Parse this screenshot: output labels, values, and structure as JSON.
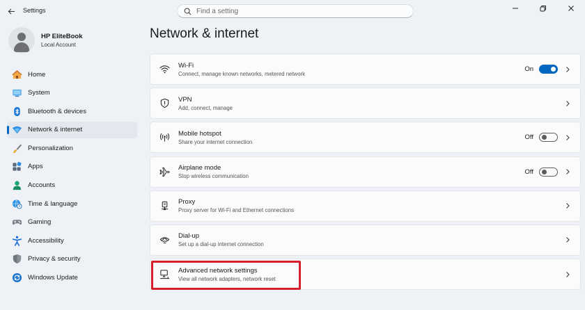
{
  "window": {
    "app_title": "Settings"
  },
  "search": {
    "placeholder": "Find a setting",
    "value": ""
  },
  "profile": {
    "name": "HP EliteBook",
    "account_type": "Local Account"
  },
  "sidebar": {
    "items": [
      {
        "label": "Home",
        "icon": "home-icon",
        "active": false
      },
      {
        "label": "System",
        "icon": "monitor-icon",
        "active": false
      },
      {
        "label": "Bluetooth & devices",
        "icon": "bluetooth-icon",
        "active": false
      },
      {
        "label": "Network & internet",
        "icon": "wifi-diamond-icon",
        "active": true
      },
      {
        "label": "Personalization",
        "icon": "brush-icon",
        "active": false
      },
      {
        "label": "Apps",
        "icon": "apps-icon",
        "active": false
      },
      {
        "label": "Accounts",
        "icon": "person-icon",
        "active": false
      },
      {
        "label": "Time & language",
        "icon": "globe-clock-icon",
        "active": false
      },
      {
        "label": "Gaming",
        "icon": "gamepad-icon",
        "active": false
      },
      {
        "label": "Accessibility",
        "icon": "accessibility-icon",
        "active": false
      },
      {
        "label": "Privacy & security",
        "icon": "shield-icon",
        "active": false
      },
      {
        "label": "Windows Update",
        "icon": "update-icon",
        "active": false
      }
    ]
  },
  "main": {
    "title": "Network & internet",
    "cards": [
      {
        "title": "Wi-Fi",
        "description": "Connect, manage known networks, metered network",
        "icon": "wifi-icon",
        "toggle": "On"
      },
      {
        "title": "VPN",
        "description": "Add, connect, manage",
        "icon": "vpn-shield-icon",
        "toggle": null
      },
      {
        "title": "Mobile hotspot",
        "description": "Share your internet connection",
        "icon": "hotspot-icon",
        "toggle": "Off"
      },
      {
        "title": "Airplane mode",
        "description": "Stop wireless communication",
        "icon": "airplane-icon",
        "toggle": "Off"
      },
      {
        "title": "Proxy",
        "description": "Proxy server for Wi-Fi and Ethernet connections",
        "icon": "proxy-icon",
        "toggle": null
      },
      {
        "title": "Dial-up",
        "description": "Set up a dial-up internet connection",
        "icon": "dialup-icon",
        "toggle": null
      },
      {
        "title": "Advanced network settings",
        "description": "View all network adapters, network reset",
        "icon": "network-pc-icon",
        "toggle": null
      }
    ]
  },
  "colors": {
    "accent": "#0067c0",
    "highlight": "#d4202a",
    "background": "#eef2f7"
  }
}
